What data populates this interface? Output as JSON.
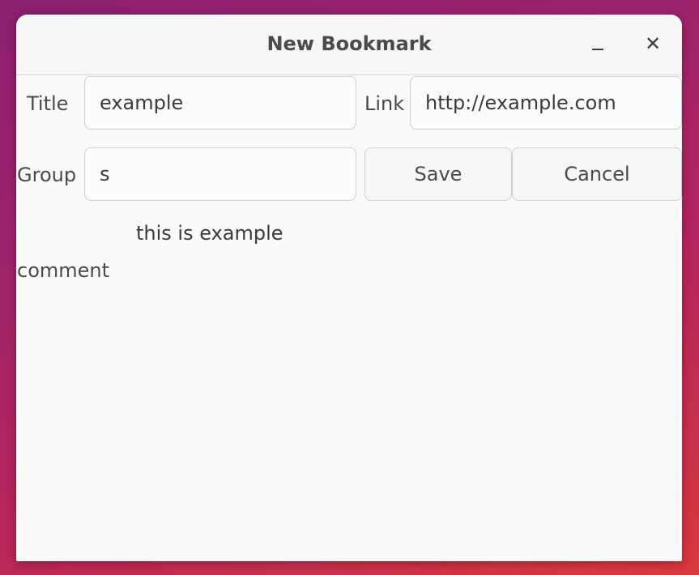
{
  "window": {
    "title": "New Bookmark",
    "minimize_icon": "minimize-icon",
    "close_glyph": "✕"
  },
  "form": {
    "title_label": "Title",
    "title_value": "example",
    "link_label": "Link",
    "link_value": "http://example.com",
    "group_label": "Group",
    "group_value": "s",
    "save_label": "Save",
    "cancel_label": "Cancel",
    "comment_label": "comment",
    "comment_value": "this is example"
  }
}
